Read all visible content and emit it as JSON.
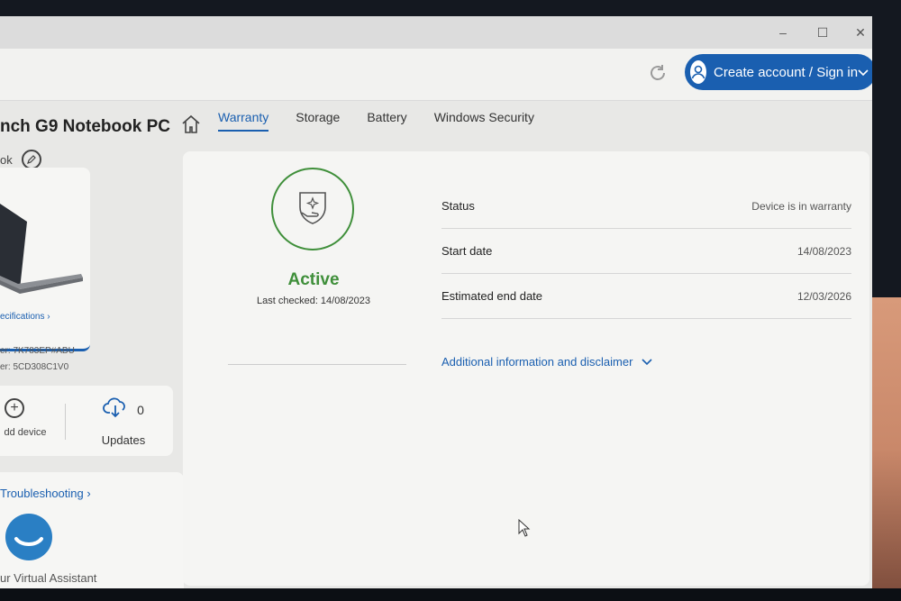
{
  "header": {
    "signin_label": "Create account / Sign in"
  },
  "window_controls": {
    "minimize": "–",
    "maximize": "☐",
    "close": "✕"
  },
  "device": {
    "name": "nch G9 Notebook PC",
    "sub_label": "ok",
    "specs_link": "ecifications ›",
    "product_line": "er: 7K783EP#ABU",
    "serial_line": "er: 5CD308C1V0"
  },
  "actions": {
    "add_device_label": "dd device",
    "updates_label": "Updates",
    "updates_count": "0"
  },
  "support": {
    "troubleshooting_link": "Troubleshooting ›",
    "virtual_assistant_label": "ur Virtual Assistant"
  },
  "tabs": [
    {
      "label": "Warranty",
      "active": true
    },
    {
      "label": "Storage",
      "active": false
    },
    {
      "label": "Battery",
      "active": false
    },
    {
      "label": "Windows Security",
      "active": false
    }
  ],
  "warranty": {
    "state": "Active",
    "last_checked": "Last checked: 14/08/2023",
    "rows": [
      {
        "label": "Status",
        "value": "Device is in warranty"
      },
      {
        "label": "Start date",
        "value": "14/08/2023"
      },
      {
        "label": "Estimated end date",
        "value": "12/03/2026"
      }
    ],
    "disclaimer_link": "Additional information and disclaimer"
  },
  "colors": {
    "accent": "#1a5fb0",
    "success": "#3f8f3a"
  },
  "icons": [
    "refresh-icon",
    "user-icon",
    "chevron-down-icon",
    "edit-icon",
    "laptop-image",
    "add-icon",
    "cloud-download-icon",
    "virtual-assistant-icon",
    "home-icon",
    "shield-hand-icon",
    "cursor-icon"
  ]
}
